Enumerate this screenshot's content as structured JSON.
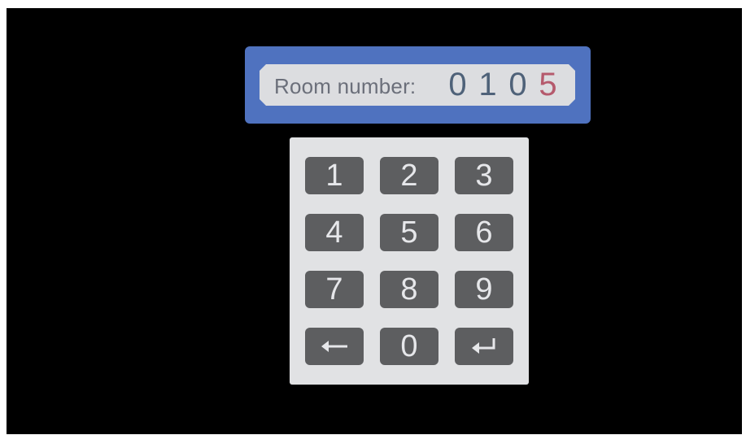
{
  "display": {
    "label": "Room number:",
    "digits": [
      "0",
      "1",
      "0",
      "5"
    ]
  },
  "keypad": {
    "keys": [
      "1",
      "2",
      "3",
      "4",
      "5",
      "6",
      "7",
      "8",
      "9",
      "0"
    ],
    "backspace_icon": "left-arrow-icon",
    "enter_icon": "enter-return-icon"
  },
  "colors": {
    "frame": "#4f72bf",
    "display_bg": "#dcdde0",
    "digit": "#4f6279",
    "active_digit": "#b55a6d",
    "keypad_bg": "#e1e2e4",
    "key_bg": "#5d5e60"
  }
}
